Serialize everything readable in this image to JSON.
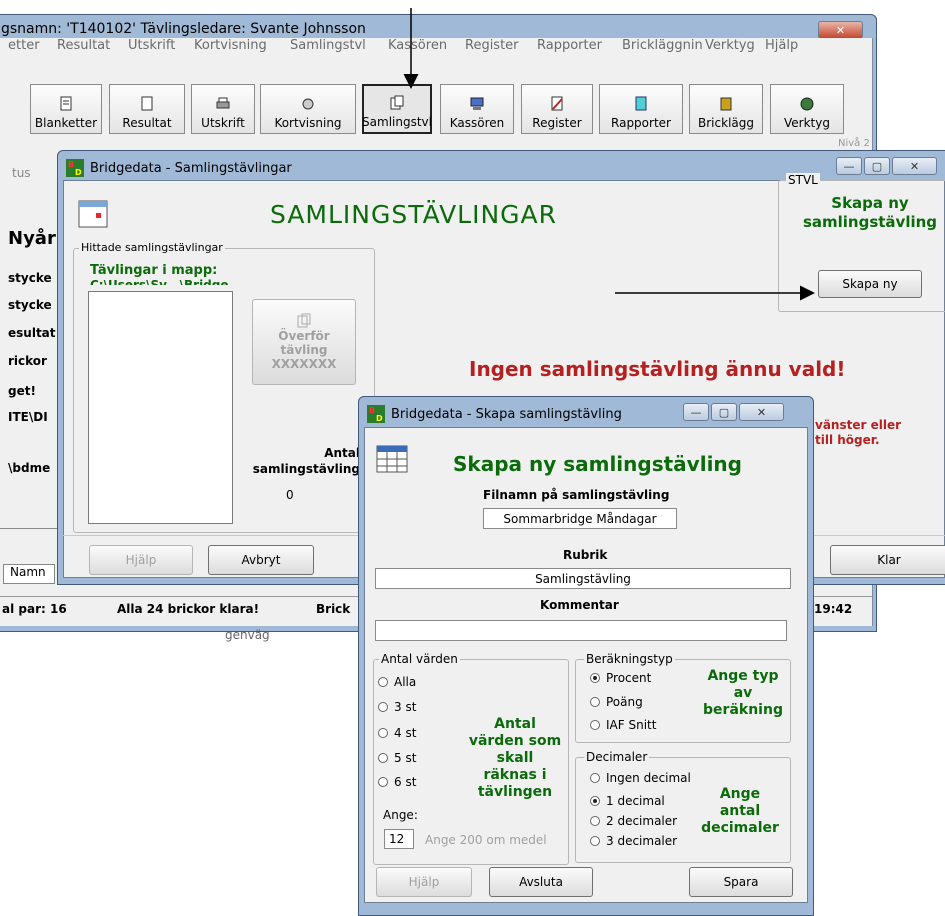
{
  "main_window": {
    "title": "gsnamn: 'T140102' Tävlingsledare: Svante Johnsson",
    "close": "✕",
    "menu": [
      "etter",
      "Resultat",
      "Utskrift",
      "Kortvisning",
      "Samlingstvl",
      "Kassören",
      "Register",
      "Rapporter",
      "Brickläggning",
      "Verktyg",
      "Hjälp"
    ],
    "toolbar": [
      "Blanketter",
      "Resultat",
      "Utskrift",
      "Kortvisning",
      "Samlingstvl",
      "Kassören",
      "Register",
      "Rapporter",
      "Bricklägg",
      "Verktyg"
    ],
    "side_texts": [
      "tus",
      "Nyår",
      "stycke",
      "stycke",
      "esultat",
      "rickor",
      "get!",
      "ITE\\DI",
      "\\bdme"
    ],
    "tab": "Namn",
    "status": [
      "al par: 16",
      "Alla 24 brickor klara!",
      "Brick",
      "19:42"
    ],
    "under_status": "genväg",
    "right_tag": "Nivå 2"
  },
  "samling_window": {
    "title": "Bridgedata - Samlingstävlingar",
    "heading": "SAMLINGSTÄVLINGAR",
    "found_group": "Hittade samlingstävlingar",
    "folder_label": "Tävlingar i mapp:",
    "folder_path": "C:\\Users\\Sv...\\Bridge",
    "transfer_button": "Överför\ntävling\nXXXXXXX",
    "count_label": "Antal\nsamlingstävling",
    "count_value": "0",
    "stvl_group": "STVL",
    "create_heading": "Skapa ny\nsamlingstävling",
    "create_button": "Skapa ny",
    "no_selection": "Ingen samlingstävling ännu vald!",
    "hint": "vänster eller\ntill höger.",
    "help_button": "Hjälp",
    "cancel_button": "Avbryt",
    "done_button": "Klar"
  },
  "dialog": {
    "title": "Bridgedata - Skapa samlingstävling",
    "heading": "Skapa ny samlingstävling",
    "filename_label": "Filnamn på samlingstävling",
    "filename_value": "Sommarbridge Måndagar",
    "rubrik_label": "Rubrik",
    "rubrik_value": "Samlingstävling",
    "kommentar_label": "Kommentar",
    "kommentar_value": "",
    "antal_group": "Antal värden",
    "antal_options": [
      "Alla",
      "3 st",
      "4 st",
      "5 st",
      "6 st"
    ],
    "antal_selected": "",
    "antal_note": "Antal\nvärden som\nskall\nräknas i\ntävlingen",
    "ange_label": "Ange:",
    "ange_value": "12",
    "ange_hint": "Ange 200 om medel",
    "berakning_group": "Beräkningstyp",
    "berakning_options": [
      "Procent",
      "Poäng",
      "IAF Snitt"
    ],
    "berakning_selected": "Procent",
    "berakning_note": "Ange typ\nav\nberäkning",
    "decimal_group": "Decimaler",
    "decimal_options": [
      "Ingen decimal",
      "1 decimal",
      "2 decimaler",
      "3 decimaler"
    ],
    "decimal_selected": "1 decimal",
    "decimal_note": "Ange\nantal\ndecimaler",
    "help_button": "Hjälp",
    "exit_button": "Avsluta",
    "save_button": "Spara"
  }
}
